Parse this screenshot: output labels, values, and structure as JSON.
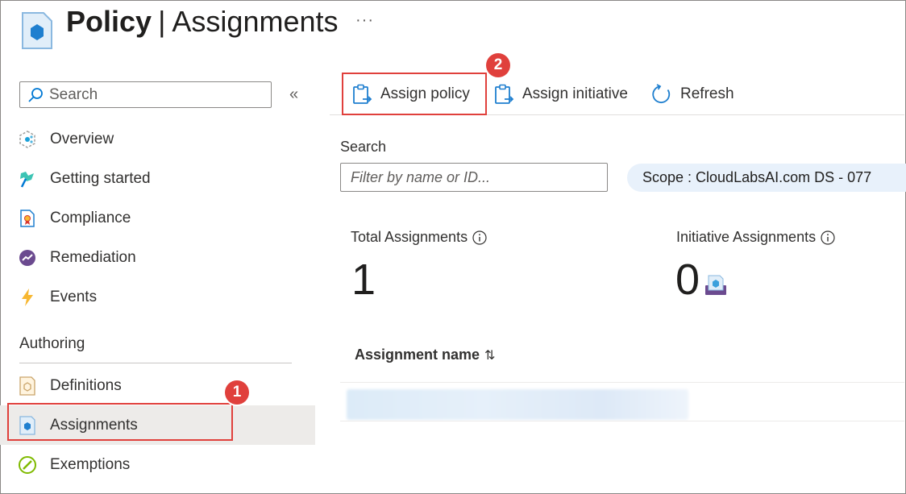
{
  "header": {
    "title_part1": "Policy",
    "separator": "|",
    "title_part2": "Assignments",
    "more_label": "···",
    "icon": "policy-hexagon-icon"
  },
  "sidebar": {
    "search_placeholder": "Search",
    "collapse_label": "«",
    "items": [
      {
        "label": "Overview",
        "icon": "overview-icon"
      },
      {
        "label": "Getting started",
        "icon": "getting-started-icon"
      },
      {
        "label": "Compliance",
        "icon": "compliance-icon"
      },
      {
        "label": "Remediation",
        "icon": "remediation-icon"
      },
      {
        "label": "Events",
        "icon": "events-lightning-icon"
      }
    ],
    "section_title": "Authoring",
    "authoring_items": [
      {
        "label": "Definitions",
        "icon": "definitions-icon"
      },
      {
        "label": "Assignments",
        "icon": "assignments-icon",
        "selected": true
      },
      {
        "label": "Exemptions",
        "icon": "exemptions-icon"
      }
    ]
  },
  "toolbar": {
    "assign_policy": "Assign policy",
    "assign_initiative": "Assign initiative",
    "refresh": "Refresh"
  },
  "filters": {
    "search_label": "Search",
    "filter_placeholder": "Filter by name or ID...",
    "scope": "Scope : CloudLabsAI.com DS - 077"
  },
  "stats": {
    "total_label": "Total Assignments",
    "total_value": "1",
    "initiative_label": "Initiative Assignments",
    "initiative_value": "0"
  },
  "table": {
    "column_assignment_name": "Assignment name",
    "sort_glyph": "⇅"
  },
  "annotations": {
    "step1": "1",
    "step2": "2",
    "highlight_color": "#e0403c"
  },
  "colors": {
    "accent": "#0078d4",
    "selected_bg": "#edebe9",
    "scope_bg": "#e8f1fb"
  }
}
